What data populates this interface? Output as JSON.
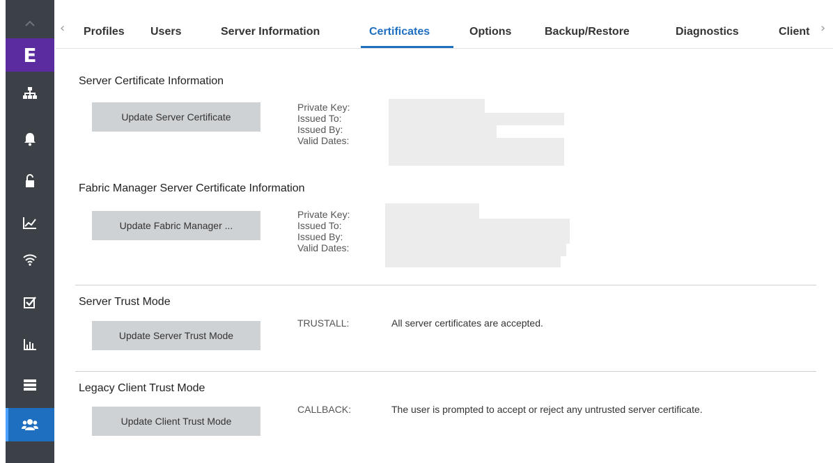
{
  "tabs": {
    "items": [
      "Profiles",
      "Users",
      "Server Information",
      "Certificates",
      "Options",
      "Backup/Restore",
      "Diagnostics",
      "Client"
    ],
    "active": "Certificates"
  },
  "sidebar": {
    "logo_letter": "E",
    "items": [
      "network-icon",
      "bell-icon",
      "unlock-icon",
      "chart-icon",
      "wifi-icon",
      "checkbox-icon",
      "bar-chart-icon",
      "server-icon",
      "users-icon"
    ],
    "active": "users-icon"
  },
  "sections": {
    "server_cert": {
      "title": "Server Certificate Information",
      "button": "Update Server Certificate",
      "labels": [
        "Private Key:",
        "Issued To:",
        "Issued By:",
        "Valid Dates:"
      ]
    },
    "fabric_cert": {
      "title": "Fabric Manager Server Certificate Information",
      "button": "Update Fabric Manager ...",
      "labels": [
        "Private Key:",
        "Issued To:",
        "Issued By:",
        "Valid Dates:"
      ]
    },
    "server_trust": {
      "title": "Server Trust Mode",
      "button": "Update Server Trust Mode",
      "label": "TRUSTALL:",
      "value": "All server certificates are accepted."
    },
    "client_trust": {
      "title": "Legacy Client Trust Mode",
      "button": "Update Client Trust Mode",
      "label": "CALLBACK:",
      "value": "The user is prompted to accept or reject any untrusted server certificate."
    }
  },
  "colors": {
    "sidebar": "#3b4147",
    "logo": "#5a2ca0",
    "accent": "#1f6fc1",
    "button": "#cfd2d4"
  }
}
